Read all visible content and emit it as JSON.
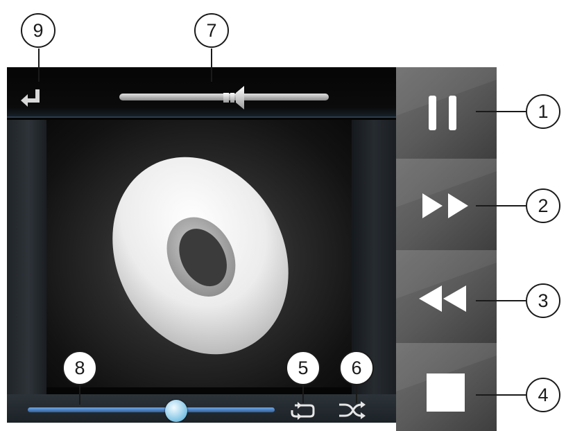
{
  "callouts": [
    {
      "id": "1",
      "label": "1"
    },
    {
      "id": "2",
      "label": "2"
    },
    {
      "id": "3",
      "label": "3"
    },
    {
      "id": "4",
      "label": "4"
    },
    {
      "id": "5",
      "label": "5"
    },
    {
      "id": "6",
      "label": "6"
    },
    {
      "id": "7",
      "label": "7"
    },
    {
      "id": "8",
      "label": "8"
    },
    {
      "id": "9",
      "label": "9"
    }
  ],
  "player": {
    "volume_level": 0.56,
    "seek_position": 0.6,
    "icons": {
      "back": "return-arrow-icon",
      "volume": "speaker-icon",
      "album_art": "disc-icon",
      "repeat": "repeat-icon",
      "shuffle": "shuffle-icon"
    }
  },
  "controls": [
    {
      "name": "pause",
      "icon": "pause-icon"
    },
    {
      "name": "fast-forward",
      "icon": "fast-forward-icon"
    },
    {
      "name": "rewind",
      "icon": "rewind-icon"
    },
    {
      "name": "stop",
      "icon": "stop-icon"
    }
  ],
  "colors": {
    "screen_bg": "#050505",
    "accent_line": "#2b3d4f",
    "seek_blue": "#3f7cc0",
    "button_gray": "#6a6a6a",
    "icon_white": "#ffffff"
  }
}
